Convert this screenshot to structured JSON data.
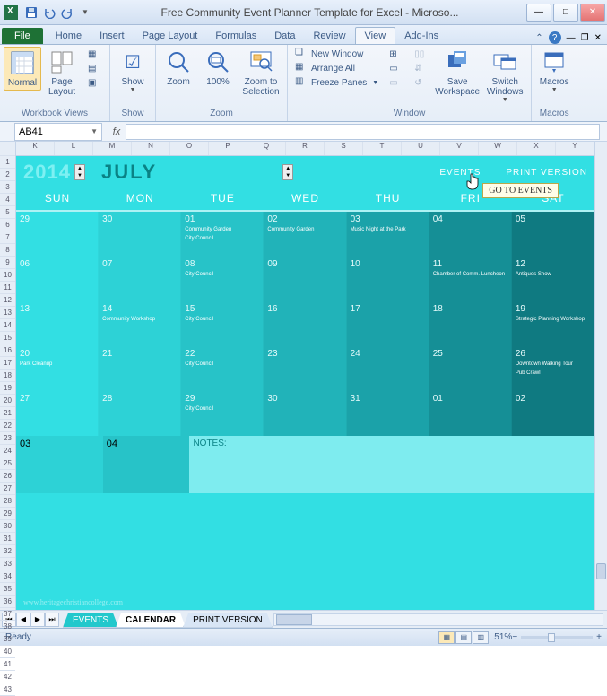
{
  "window": {
    "title": "Free Community Event Planner Template for Excel - Microso..."
  },
  "tabs": {
    "file": "File",
    "items": [
      "Home",
      "Insert",
      "Page Layout",
      "Formulas",
      "Data",
      "Review",
      "View",
      "Add-Ins"
    ],
    "active": "View"
  },
  "ribbon": {
    "workbook_views": {
      "label": "Workbook Views",
      "normal": "Normal",
      "page_layout": "Page\nLayout"
    },
    "show": {
      "label": "Show",
      "btn": "Show"
    },
    "zoom": {
      "label": "Zoom",
      "zoom": "Zoom",
      "hundred": "100%",
      "to_sel": "Zoom to\nSelection"
    },
    "window": {
      "label": "Window",
      "new_window": "New Window",
      "arrange": "Arrange All",
      "freeze": "Freeze Panes",
      "save_ws": "Save\nWorkspace",
      "switch": "Switch\nWindows"
    },
    "macros": {
      "label": "Macros",
      "btn": "Macros"
    }
  },
  "namebox": "AB41",
  "fx_label": "fx",
  "colheaders": [
    "K",
    "L",
    "M",
    "N",
    "O",
    "P",
    "Q",
    "R",
    "S",
    "T",
    "U",
    "V",
    "W",
    "X",
    "Y"
  ],
  "rowheaders": [
    "",
    "1",
    "2",
    "3",
    "4",
    "5",
    "6",
    "7",
    "8",
    "9",
    "10",
    "11",
    "12",
    "13",
    "14",
    "15",
    "16",
    "17",
    "18",
    "19",
    "20",
    "21",
    "22",
    "23",
    "24",
    "25",
    "26",
    "27",
    "28",
    "29",
    "30",
    "31",
    "32",
    "33",
    "34",
    "35",
    "36",
    "37",
    "38",
    "39",
    "40",
    "41",
    "42",
    "43"
  ],
  "calendar": {
    "year": "2014",
    "month": "JULY",
    "events_link": "EVENTS",
    "print_link": "PRINT VERSION",
    "tooltip": "GO TO EVENTS",
    "dow": [
      "SUN",
      "MON",
      "TUE",
      "WED",
      "THU",
      "FRI",
      "SAT"
    ],
    "weeks": [
      [
        {
          "n": "29"
        },
        {
          "n": "30"
        },
        {
          "n": "01",
          "e": [
            "Community Garden",
            "City Council"
          ]
        },
        {
          "n": "02",
          "e": [
            "Community Garden"
          ]
        },
        {
          "n": "03",
          "e": [
            "Music Night at the Park"
          ]
        },
        {
          "n": "04"
        },
        {
          "n": "05"
        }
      ],
      [
        {
          "n": "06"
        },
        {
          "n": "07"
        },
        {
          "n": "08",
          "e": [
            "City Council"
          ]
        },
        {
          "n": "09"
        },
        {
          "n": "10"
        },
        {
          "n": "11",
          "e": [
            "Chamber of Comm. Luncheon"
          ]
        },
        {
          "n": "12",
          "e": [
            "Antiques Show"
          ]
        }
      ],
      [
        {
          "n": "13"
        },
        {
          "n": "14",
          "e": [
            "Community Workshop"
          ]
        },
        {
          "n": "15",
          "e": [
            "City Council"
          ]
        },
        {
          "n": "16"
        },
        {
          "n": "17"
        },
        {
          "n": "18"
        },
        {
          "n": "19",
          "e": [
            "Strategic Planning Workshop"
          ]
        }
      ],
      [
        {
          "n": "20",
          "e": [
            "Park Cleanup"
          ]
        },
        {
          "n": "21"
        },
        {
          "n": "22",
          "e": [
            "City Council"
          ]
        },
        {
          "n": "23"
        },
        {
          "n": "24"
        },
        {
          "n": "25"
        },
        {
          "n": "26",
          "e": [
            "Downtown Walking Tour",
            "Pub Crawl"
          ]
        }
      ],
      [
        {
          "n": "27"
        },
        {
          "n": "28"
        },
        {
          "n": "29",
          "e": [
            "City Council"
          ]
        },
        {
          "n": "30"
        },
        {
          "n": "31"
        },
        {
          "n": "01"
        },
        {
          "n": "02"
        }
      ]
    ],
    "notes_row": {
      "n1": "03",
      "n2": "04",
      "notes_label": "NOTES:"
    },
    "watermark": "www.heritagechristiancollege.com"
  },
  "sheettabs": {
    "events": "EVENTS",
    "calendar": "CALENDAR",
    "print": "PRINT VERSION"
  },
  "statusbar": {
    "ready": "Ready",
    "zoom": "51%"
  }
}
